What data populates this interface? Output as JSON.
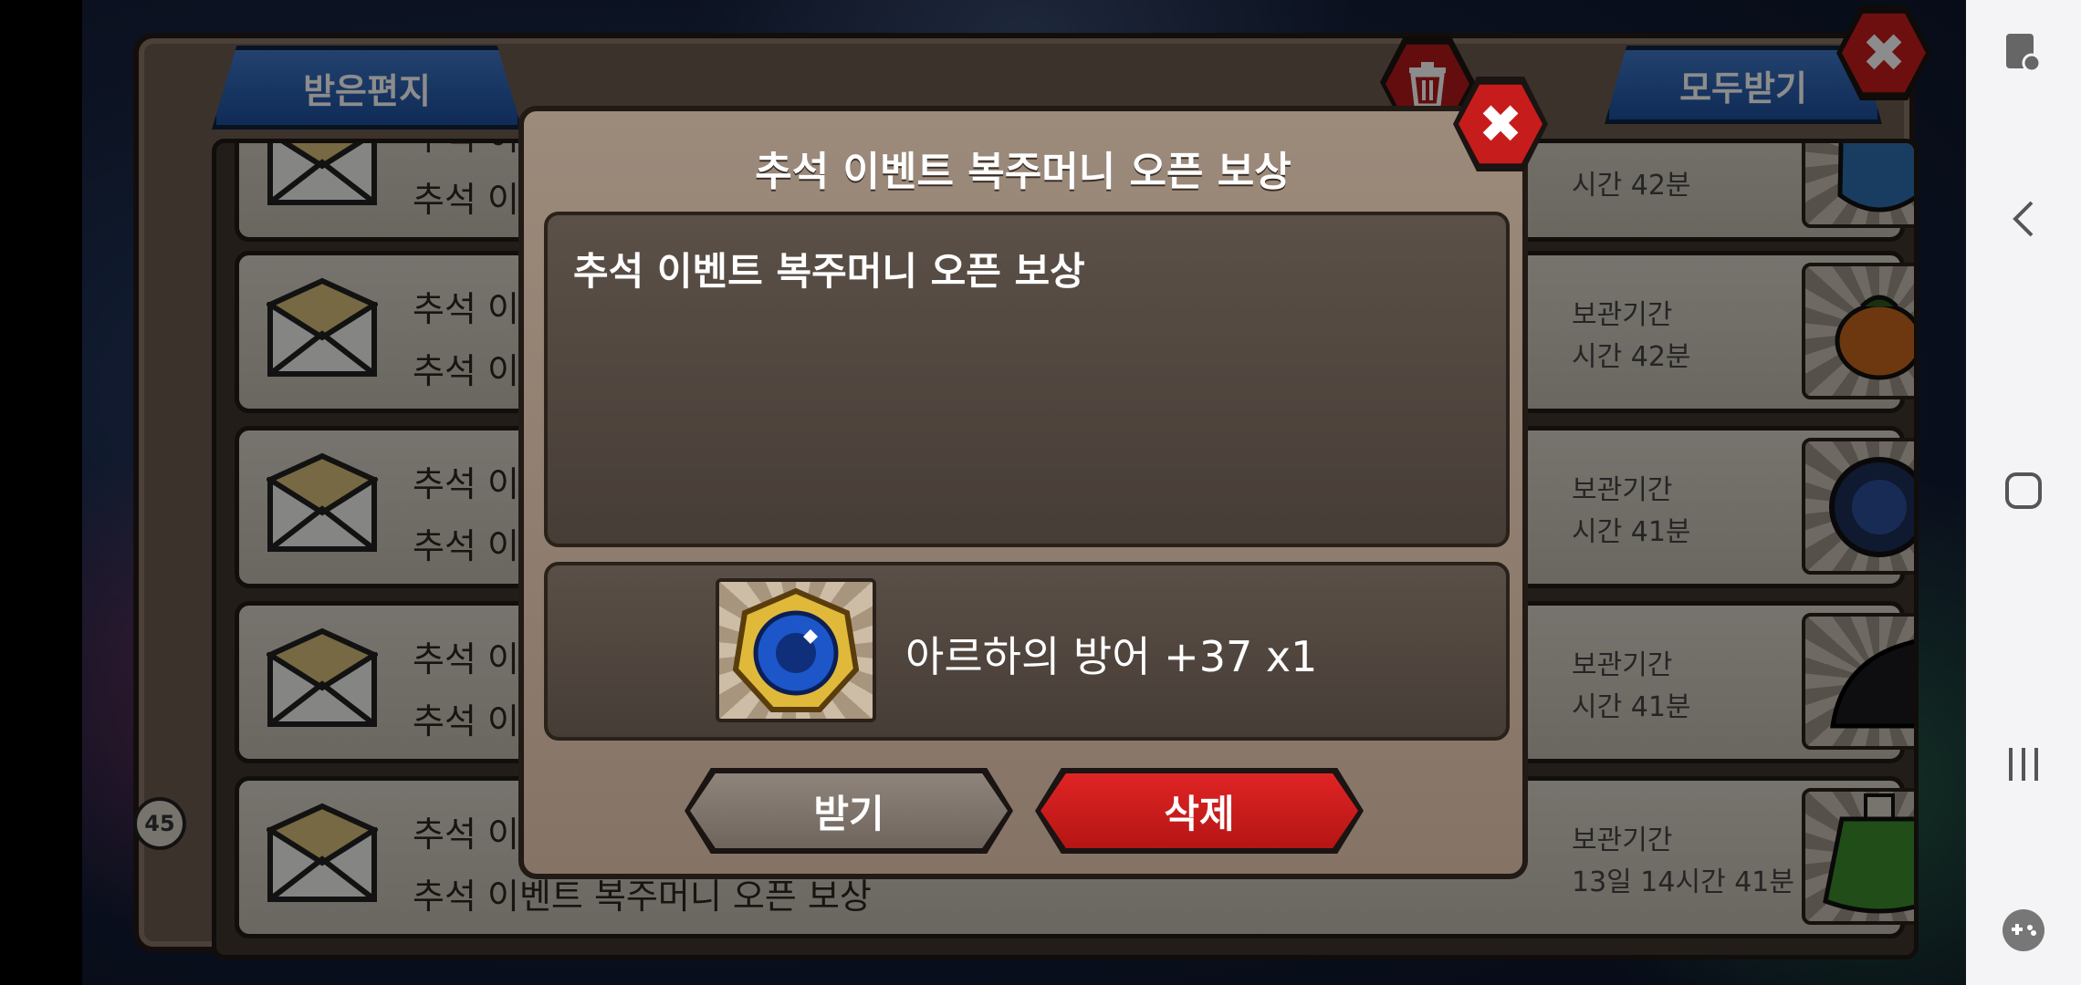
{
  "mailbox": {
    "tab_received": "받은편지",
    "receive_all": "모두받기",
    "rows": [
      {
        "title": "추석 이벤",
        "subtitle": "추석 이벤",
        "storage_label": "",
        "remaining": "시간 42분"
      },
      {
        "title": "추석 이벤",
        "subtitle": "추석 이벤",
        "storage_label": "보관기간",
        "remaining": "시간 42분"
      },
      {
        "title": "추석 이벤",
        "subtitle": "추석 이벤",
        "storage_label": "보관기간",
        "remaining": "시간 41분"
      },
      {
        "title": "추석 이벤",
        "subtitle": "추석 이벤",
        "storage_label": "보관기간",
        "remaining": "시간 41분"
      },
      {
        "title": "추석 이벤",
        "subtitle": "추석 이벤트 복주머니 오픈 보상",
        "storage_label": "보관기간",
        "remaining": "13일 14시간 41분"
      }
    ],
    "side_badge_number": "45"
  },
  "dialog": {
    "title": "추석 이벤트 복주머니 오픈 보상",
    "message": "추석 이벤트 복주머니 오픈 보상",
    "reward_text": "아르하의 방어 +37 x1",
    "receive_button": "받기",
    "delete_button": "삭제"
  },
  "colors": {
    "accent_red": "#c71c1c",
    "tab_blue": "#2f66b8",
    "panel_brown": "#857466"
  },
  "icons": {
    "close": "close-icon",
    "trash": "trash-icon",
    "envelope": "envelope-icon",
    "nav_back": "back-icon",
    "nav_home": "home-icon",
    "nav_recent": "recent-apps-icon",
    "nav_game": "game-tools-icon"
  }
}
